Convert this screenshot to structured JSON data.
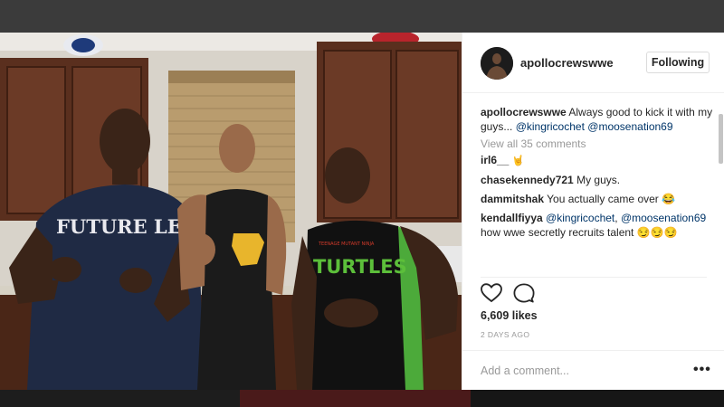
{
  "post": {
    "username": "apollocrewswwe",
    "follow_label": "Following",
    "caption": {
      "user": "apollocrewswwe",
      "text": "Always good to kick it with my guys...",
      "mention1": "@kingricochet",
      "mention2": "@moosenation69"
    },
    "view_all": "View all 35 comments",
    "comments": [
      {
        "user": "irl6__",
        "text": "🤘"
      },
      {
        "user": "chasekennedy721",
        "text": "My guys."
      },
      {
        "user": "dammitshak",
        "text": "You actually came over 😂"
      },
      {
        "user": "kendallfiyya",
        "mention1": "@kingricochet",
        "sep": ",",
        "mention2": "@moosenation69",
        "text": "how wwe secretly recruits talent 😏😏😏"
      }
    ],
    "likes": "6,609 likes",
    "date": "2 DAYS AGO",
    "comment_placeholder": "Add a comment...",
    "more_label": "•••"
  },
  "icons": {
    "like": "heart-icon",
    "comment": "comment-bubble-icon",
    "more": "more-options-icon"
  },
  "photo": {
    "shirt_text_left": "FUTURE LEGEND",
    "shirt_text_right": "TURTLES",
    "shirt_small_right": "TEENAGE MUTANT NINJA"
  },
  "colors": {
    "mention": "#003569",
    "muted": "#999999",
    "text": "#262626"
  }
}
